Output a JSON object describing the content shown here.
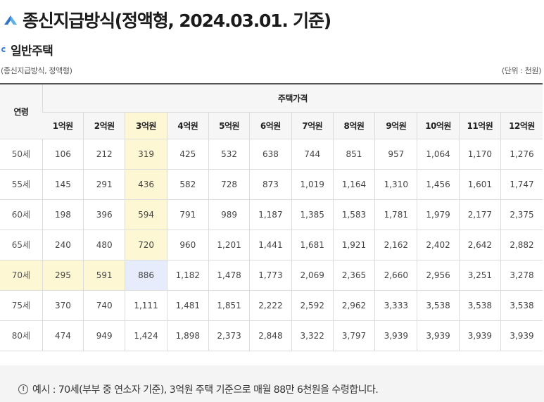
{
  "header": {
    "title": "종신지급방식(정액형, 2024.03.01. 기준)",
    "subtitle": "일반주택"
  },
  "notes": {
    "left": "(종신지급방식, 정액형)",
    "right": "(단위 : 천원)"
  },
  "table": {
    "age_header": "연령",
    "group_header": "주택가격",
    "columns": [
      "1억원",
      "2억원",
      "3억원",
      "4억원",
      "5억원",
      "6억원",
      "7억원",
      "8억원",
      "9억원",
      "10억원",
      "11억원",
      "12억원"
    ],
    "rows": [
      {
        "age": "50세",
        "values": [
          "106",
          "212",
          "319",
          "425",
          "532",
          "638",
          "744",
          "851",
          "957",
          "1,064",
          "1,170",
          "1,276"
        ]
      },
      {
        "age": "55세",
        "values": [
          "145",
          "291",
          "436",
          "582",
          "728",
          "873",
          "1,019",
          "1,164",
          "1,310",
          "1,456",
          "1,601",
          "1,747"
        ]
      },
      {
        "age": "60세",
        "values": [
          "198",
          "396",
          "594",
          "791",
          "989",
          "1,187",
          "1,385",
          "1,583",
          "1,781",
          "1,979",
          "2,177",
          "2,375"
        ]
      },
      {
        "age": "65세",
        "values": [
          "240",
          "480",
          "720",
          "960",
          "1,201",
          "1,441",
          "1,681",
          "1,921",
          "2,162",
          "2,402",
          "2,642",
          "2,882"
        ]
      },
      {
        "age": "70세",
        "values": [
          "295",
          "591",
          "886",
          "1,182",
          "1,478",
          "1,773",
          "2,069",
          "2,365",
          "2,660",
          "2,956",
          "3,251",
          "3,278"
        ]
      },
      {
        "age": "75세",
        "values": [
          "370",
          "740",
          "1,111",
          "1,481",
          "1,851",
          "2,222",
          "2,592",
          "2,962",
          "3,333",
          "3,538",
          "3,538",
          "3,538"
        ]
      },
      {
        "age": "80세",
        "values": [
          "474",
          "949",
          "1,424",
          "1,898",
          "2,373",
          "2,848",
          "3,322",
          "3,797",
          "3,939",
          "3,939",
          "3,939",
          "3,939"
        ]
      }
    ]
  },
  "example": {
    "icon_glyph": "!",
    "text": "예시 : 70세(부부 중 연소자 기준), 3억원 주택 기준으로 매월 88만 6천원을 수령합니다."
  },
  "colors": {
    "accent": "#3a7bd5",
    "highlight": "#fdf7d4",
    "cross_highlight": "#e6ecfb"
  },
  "icons": {
    "title": "chevron-up-icon",
    "subtitle": "half-circle-bullet-icon",
    "example": "info-icon"
  }
}
